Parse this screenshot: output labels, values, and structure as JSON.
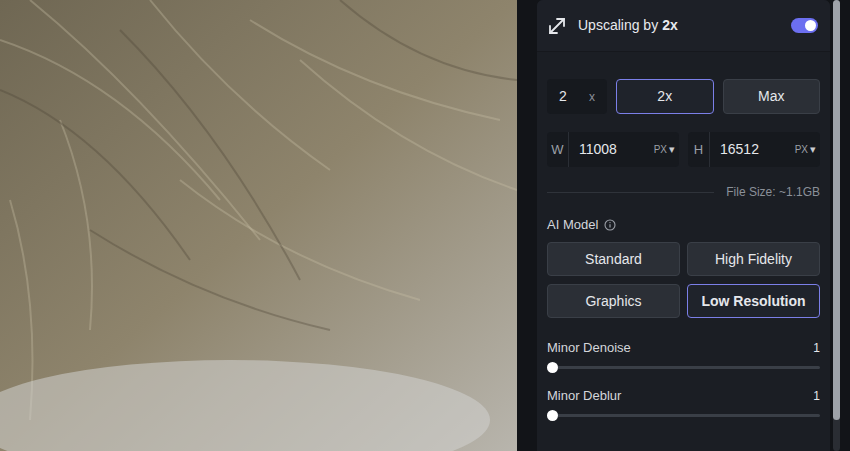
{
  "upscale": {
    "title": "Upscaling by",
    "factor": "2x",
    "enabled": true
  },
  "scale": {
    "value": "2",
    "unit": "x",
    "options": [
      {
        "label": "2x",
        "selected": true
      },
      {
        "label": "Max",
        "selected": false
      }
    ]
  },
  "dimensions": [
    {
      "label": "W",
      "value": "11008",
      "unit": "PX",
      "dropdown": "▾"
    },
    {
      "label": "H",
      "value": "16512",
      "unit": "PX",
      "dropdown": "▾"
    }
  ],
  "file_size": "File Size: ~1.1GB",
  "ai_model": {
    "label": "AI Model",
    "models": [
      {
        "label": "Standard",
        "selected": false
      },
      {
        "label": "High Fidelity",
        "selected": false
      },
      {
        "label": "Graphics",
        "selected": false
      },
      {
        "label": "Low Resolution",
        "selected": true
      }
    ]
  },
  "sliders": [
    {
      "label": "Minor Denoise",
      "reading": "1",
      "level": 0
    },
    {
      "label": "Minor Deblur",
      "reading": "1",
      "level": 0
    }
  ]
}
